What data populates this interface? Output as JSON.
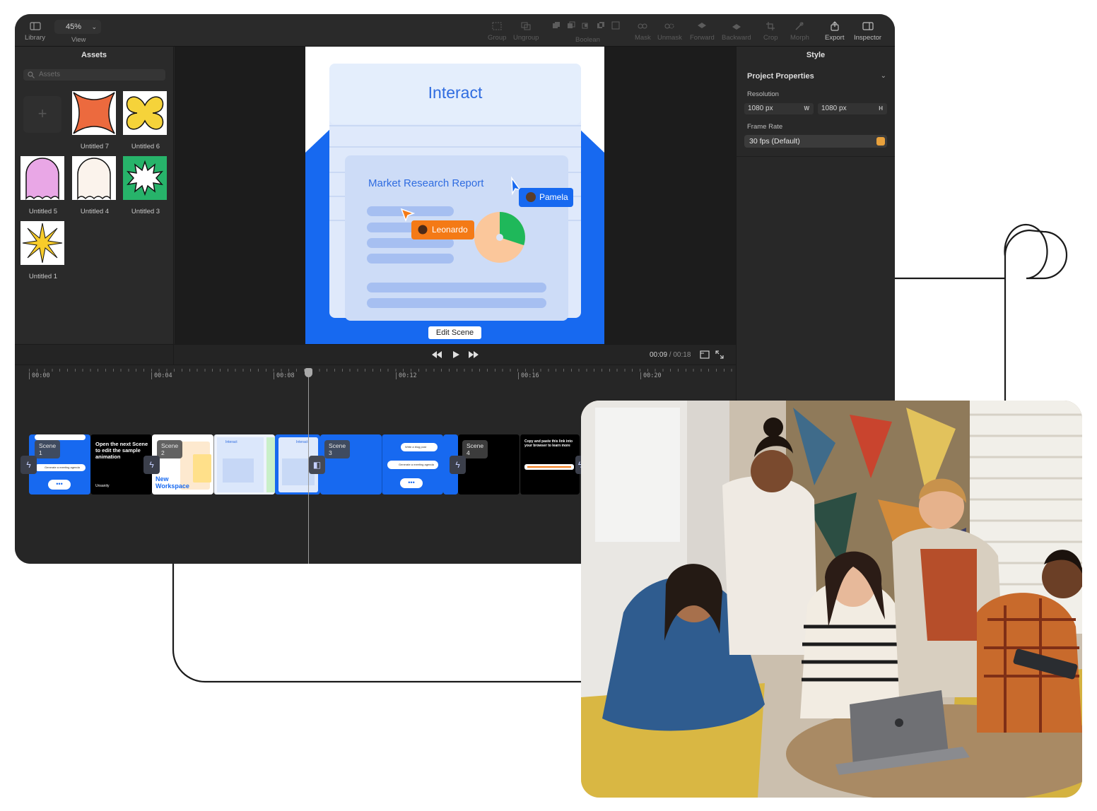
{
  "toolbar": {
    "library": "Library",
    "zoom": "45%",
    "view": "View",
    "group": "Group",
    "ungroup": "Ungroup",
    "boolean": "Boolean",
    "mask": "Mask",
    "unmask": "Unmask",
    "forward": "Forward",
    "backward": "Backward",
    "crop": "Crop",
    "morph": "Morph",
    "export": "Export",
    "inspector": "Inspector"
  },
  "assets": {
    "title": "Assets",
    "search_placeholder": "Assets",
    "add_label": "+",
    "items": [
      {
        "label": "Untitled 7",
        "color": "#ec6a3e",
        "shape": "bowtie"
      },
      {
        "label": "Untitled 6",
        "color": "#f5d33a",
        "shape": "clover"
      },
      {
        "label": "Untitled 5",
        "color": "#e9a7e6",
        "shape": "ghost"
      },
      {
        "label": "Untitled 4",
        "color": "#fbf3ec",
        "shape": "ghost"
      },
      {
        "label": "Untitled 3",
        "color": "#27b36a",
        "shape": "burst"
      },
      {
        "label": "Untitled 1",
        "color": "#f8cc2a",
        "shape": "star"
      }
    ]
  },
  "canvas": {
    "card_title": "Interact",
    "report_title": "Market Research Report",
    "cursor_pamela": "Pamela",
    "cursor_leonardo": "Leonardo",
    "edit_scene": "Edit Scene",
    "pie": {
      "green_fraction": 0.3
    }
  },
  "style": {
    "title": "Style",
    "section": "Project Properties",
    "resolution_label": "Resolution",
    "width": "1080 px",
    "width_suffix": "W",
    "height": "1080 px",
    "height_suffix": "H",
    "frame_rate_label": "Frame Rate",
    "frame_rate": "30 fps (Default)"
  },
  "transport": {
    "current": "00:09",
    "separator": " / ",
    "total": "00:18"
  },
  "timeline": {
    "ticks": [
      "00:00",
      "00:04",
      "00:08",
      "00:12",
      "00:16",
      "00:20"
    ],
    "scenes": [
      {
        "label": "Scene 1",
        "text": "Open the next Scene to edit the sample animation",
        "brand": "Unsanity"
      },
      {
        "label": "Scene 2",
        "text": "New Workspace",
        "mini_title": "Interact"
      },
      {
        "label": "Scene 3",
        "pill1": "Write a blog post",
        "pill2": "Generate a meeting agenda"
      },
      {
        "label": "Scene 4",
        "text": "Copy and paste this link into your browser to learn more"
      }
    ],
    "scene1_pill1": "Generate a meeting agenda",
    "scene1_pill2": "Generate a meeting agenda"
  }
}
